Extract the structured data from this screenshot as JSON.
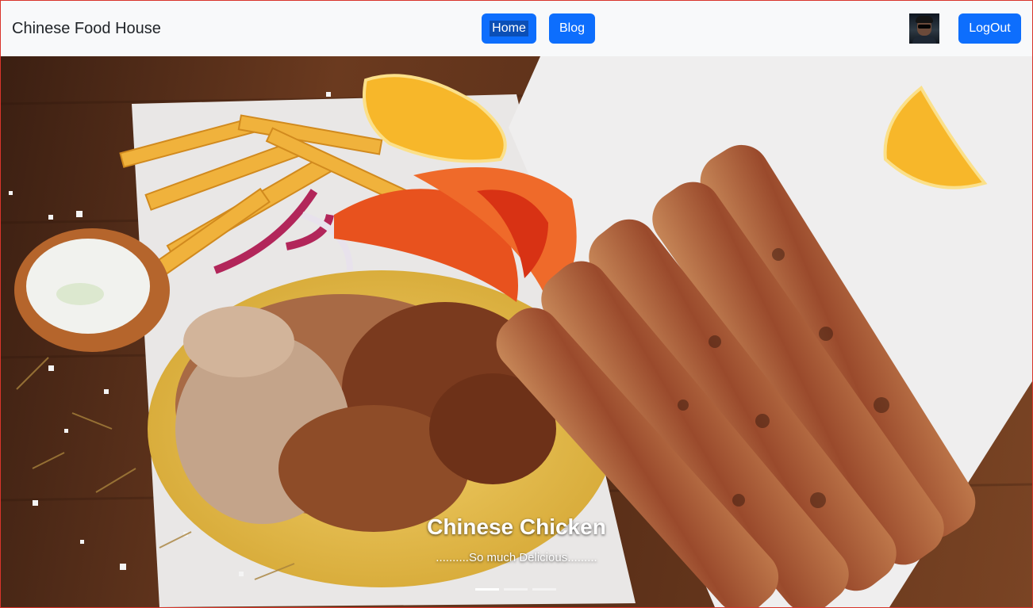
{
  "navbar": {
    "brand": "Chinese Food House",
    "home_label": "Home",
    "blog_label": "Blog",
    "logout_label": "LogOut"
  },
  "carousel": {
    "slide_title": "Chinese Chicken",
    "slide_caption": "..........So much Delicious.........",
    "indicators": 3,
    "active_indicator": 1
  },
  "colors": {
    "primary": "#0d6efd",
    "navbar_bg": "#f8f9fa",
    "frame_border": "#d9342b"
  }
}
